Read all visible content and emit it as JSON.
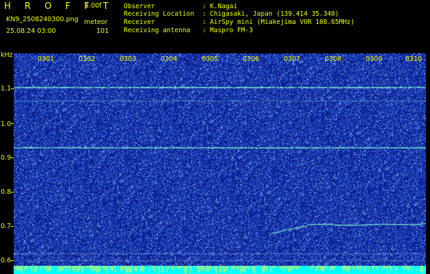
{
  "header": {
    "app_title": "H R O F F T",
    "version": "1.00f",
    "filename": "KN9_2508240300.png",
    "mode_label": "meteor",
    "datetime": "25.08.24 03:00",
    "count": "101"
  },
  "info": [
    {
      "label": "Observer",
      "value": "K.Nagai"
    },
    {
      "label": "Receiving Location",
      "value": "Chigasaki, Japan (139.414 35.340)"
    },
    {
      "label": "Receiver",
      "value": "AirSpy mini (Miakejima VOR 108.65MHz)"
    },
    {
      "label": "Receiving antenna",
      "value": "Maspro FM-3"
    }
  ],
  "axis": {
    "unit": "kHz",
    "freq_labels": [
      "1.1",
      "1.0",
      "0.9",
      "0.8",
      "0.7",
      "0.6"
    ],
    "time_labels": [
      "0301",
      "0302",
      "0303",
      "0304",
      "0305",
      "0306",
      "0307",
      "0308",
      "0309",
      "0310"
    ]
  },
  "colors": {
    "background": "#000000",
    "spectrogram": "#0a1d8a",
    "noise": "#5a8cff",
    "carrier": "#7fffd0",
    "text": "#f0ff00",
    "bottom_bar": "#00ffff"
  }
}
